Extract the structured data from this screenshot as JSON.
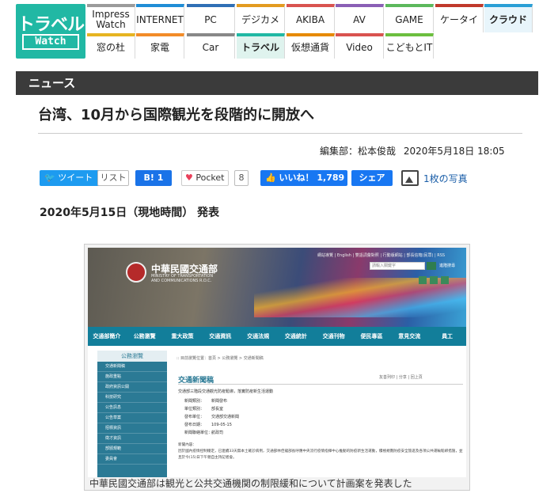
{
  "logo": {
    "line1": "トラベル",
    "line2": "Watch"
  },
  "nav_row1": [
    "Impress Watch",
    "INTERNET",
    "PC",
    "デジカメ",
    "AKIBA",
    "AV",
    "GAME",
    "ケータイ",
    "クラウド"
  ],
  "nav_row2": [
    "窓の杜",
    "家電",
    "Car",
    "トラベル",
    "仮想通貨",
    "Video",
    "こどもとIT"
  ],
  "nav_row1_colors": [
    "#9b9b9b",
    "#1f8dd6",
    "#2f6fb5",
    "#e39b20",
    "#d9534f",
    "#8a5fb5",
    "#5cb85c",
    "#c0392b",
    "#2a9fd6"
  ],
  "nav_row2_colors": [
    "#e6b422",
    "#f28c28",
    "#888888",
    "#21b8a4",
    "#e68a00",
    "#d9534f",
    "#6cbf3f"
  ],
  "section_label": "ニュース",
  "article": {
    "title": "台湾、10月から国際観光を段階的に開放へ",
    "author": "編集部：松本俊哉",
    "datetime": "2020年5月18日 18:05",
    "date_heading": "2020年5月15日（現地時間） 発表"
  },
  "share": {
    "tweet": "ツイート",
    "list": "リスト",
    "hatena": "B! 1",
    "pocket": "Pocket",
    "pocket_count": "8",
    "like": "いいね！ 1,789",
    "share": "シェア",
    "photos": "1枚の写真"
  },
  "figure": {
    "caption": "中華民國交通部は観光と公共交通機関の制限緩和について計画案を発表した",
    "site_name": "中華民國交通部",
    "site_en": "MINISTRY OF TRANSPORTATION AND COMMUNICATIONS R.O.C.",
    "top_links": "網站導覽 | English | 雙語詞彙對照 | 行動版網站 | 部長信箱(民眾) | RSS",
    "search_placeholder": "請輸入關鍵字",
    "search_link": "進階搜尋",
    "menu": [
      "交通部簡介",
      "公務瀏覽",
      "重大政策",
      "交通資訊",
      "交通法規",
      "交通統計",
      "交通刊物",
      "便民專區",
      "意見交流",
      "員工"
    ],
    "sidebar_title": "公務瀏覽",
    "sidebar_items": [
      "交通新聞稿",
      "施政重點",
      "政府資訊公開",
      "科技研究",
      "公告訊息",
      "公告草案",
      "招標資訊",
      "徵才資訊",
      "部頒規範",
      "委員會"
    ],
    "breadcrumb": ":: 目前瀏覽位置：首頁 > 公務瀏覽 > 交通新聞稿",
    "page_title": "交通新聞稿",
    "page_tools": "友善列印 | 分享 | 回上頁",
    "release_title": "交通部三階段交通觀光防疫鬆綁，落實防疫新生活運動",
    "rows": [
      {
        "k": "新聞類別：",
        "v": "新聞發布"
      },
      {
        "k": "單位類別：",
        "v": "部長室"
      },
      {
        "k": "發布單位：",
        "v": "交通部交通新聞"
      },
      {
        "k": "發布日期：",
        "v": "109-05-15"
      },
      {
        "k": "新聞聯絡單位：",
        "v": "航政司"
      }
    ],
    "body_heading": "新聞內容：",
    "body": "因於國內疫情控制穩定，已連續33天無本土確診病例，交通部林佳龍部長呼應中央流行疫情指揮中心推動的防疫新生活運動，積極規劃防疫安全旅遊及各項公共運輸鬆綁措施，並且於今(15)日下午親自主持記者會。"
  }
}
